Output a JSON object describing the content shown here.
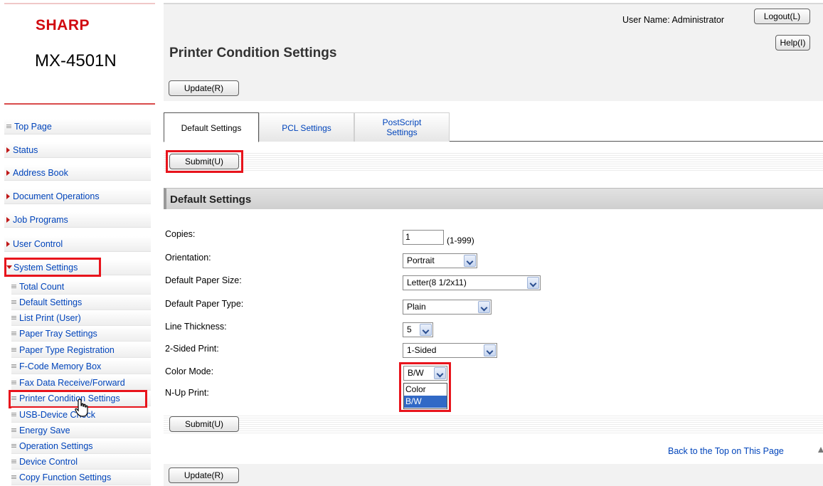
{
  "brand": {
    "logo": "SHARP",
    "model": "MX-4501N"
  },
  "sidebar": {
    "items": [
      {
        "label": "Top Page",
        "marker": "bullet"
      },
      {
        "label": "Status",
        "marker": "arrow"
      },
      {
        "label": "Address Book",
        "marker": "arrow"
      },
      {
        "label": "Document Operations",
        "marker": "arrow"
      },
      {
        "label": "Job Programs",
        "marker": "arrow"
      },
      {
        "label": "User Control",
        "marker": "arrow"
      },
      {
        "label": "System Settings",
        "marker": "arrow-down"
      }
    ],
    "subitems": [
      "Total Count",
      "Default Settings",
      "List Print (User)",
      "Paper Tray Settings",
      "Paper Type Registration",
      "F-Code Memory Box",
      "Fax Data Receive/Forward",
      "Printer Condition Settings",
      "USB-Device Check",
      "Energy Save",
      "Operation Settings",
      "Device Control",
      "Copy Function Settings"
    ]
  },
  "header": {
    "user_label": "User Name: Administrator",
    "logout_label": "Logout(L)",
    "help_label": "Help(I)",
    "title": "Printer Condition Settings",
    "update_label": "Update(R)"
  },
  "tabs": [
    {
      "label": "Default Settings",
      "active": true
    },
    {
      "label": "PCL Settings",
      "active": false
    },
    {
      "label": "PostScript Settings",
      "active": false
    }
  ],
  "submit_label": "Submit(U)",
  "section_title": "Default Settings",
  "form": {
    "copies": {
      "label": "Copies:",
      "value": "1",
      "hint": "(1-999)"
    },
    "orientation": {
      "label": "Orientation:",
      "value": "Portrait"
    },
    "paper_size": {
      "label": "Default Paper Size:",
      "value": "Letter(8 1/2x11)"
    },
    "paper_type": {
      "label": "Default Paper Type:",
      "value": "Plain"
    },
    "line_thickness": {
      "label": "Line Thickness:",
      "value": "5"
    },
    "two_sided": {
      "label": "2-Sided Print:",
      "value": "1-Sided"
    },
    "color_mode": {
      "label": "Color Mode:",
      "value": "B/W",
      "options": [
        "Color",
        "B/W"
      ],
      "selected_index": 1
    },
    "n_up": {
      "label": "N-Up Print:"
    }
  },
  "footer": {
    "back_to_top": "Back to the Top on This Page",
    "update_label": "Update(R)"
  },
  "colors": {
    "brand_red": "#d10a10",
    "link_blue": "#0044bb",
    "highlight_red": "#e8141c",
    "selection_blue": "#3169c6"
  }
}
